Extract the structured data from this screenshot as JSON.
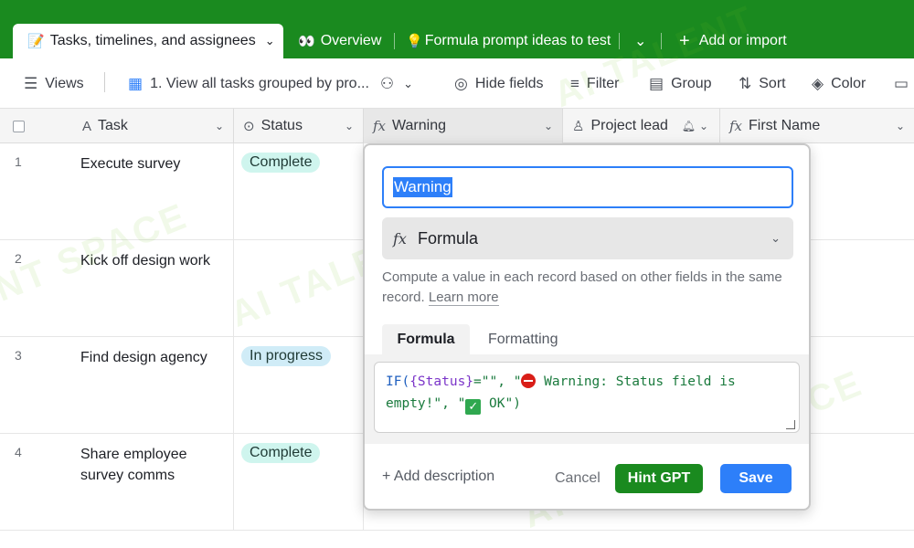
{
  "tabs": [
    {
      "emoji": "📝",
      "label": "Tasks, timelines, and assignees",
      "chevron": "⌄"
    },
    {
      "emoji": "👀",
      "label": "Overview"
    },
    {
      "emoji": "💡",
      "label": "Formula prompt ideas to test",
      "chevron": "⌄"
    },
    {
      "icon": "+",
      "label": "Add or import"
    }
  ],
  "toolbar": {
    "views_label": "Views",
    "view_name": "1. View all tasks grouped by pro...",
    "hide_fields": "Hide fields",
    "filter": "Filter",
    "group": "Group",
    "sort": "Sort",
    "color": "Color"
  },
  "columns": {
    "task": "Task",
    "status": "Status",
    "warning": "Warning",
    "project_lead": "Project lead",
    "first_name": "First Name"
  },
  "rows": [
    {
      "num": "1",
      "task": "Execute survey",
      "status": "Complete",
      "status_color": "#cff5ee"
    },
    {
      "num": "2",
      "task": "Kick off design work",
      "status": "",
      "status_color": ""
    },
    {
      "num": "3",
      "task": "Find design agency",
      "status": "In progress",
      "status_color": "#d0ecf7"
    },
    {
      "num": "4",
      "task": "Share employee survey comms",
      "status": "Complete",
      "status_color": "#cff5ee"
    }
  ],
  "modal": {
    "field_name": "Warning",
    "type_label": "Formula",
    "description": "Compute a value in each record based on other fields in the same record.",
    "learn_more": "Learn more",
    "tab_formula": "Formula",
    "tab_formatting": "Formatting",
    "formula": {
      "fn": "IF(",
      "field": "{Status}",
      "op": "=\"\", \"",
      "warning_text": " Warning: Status field is empty!\", \"",
      "ok_text": " OK\")"
    },
    "add_description": "+ Add description",
    "cancel": "Cancel",
    "hint_gpt": "Hint GPT",
    "save": "Save"
  },
  "colors": {
    "brand_green": "#1a8a1f",
    "primary_blue": "#2d7ff9"
  },
  "watermark": "AI TALENT SPACE"
}
